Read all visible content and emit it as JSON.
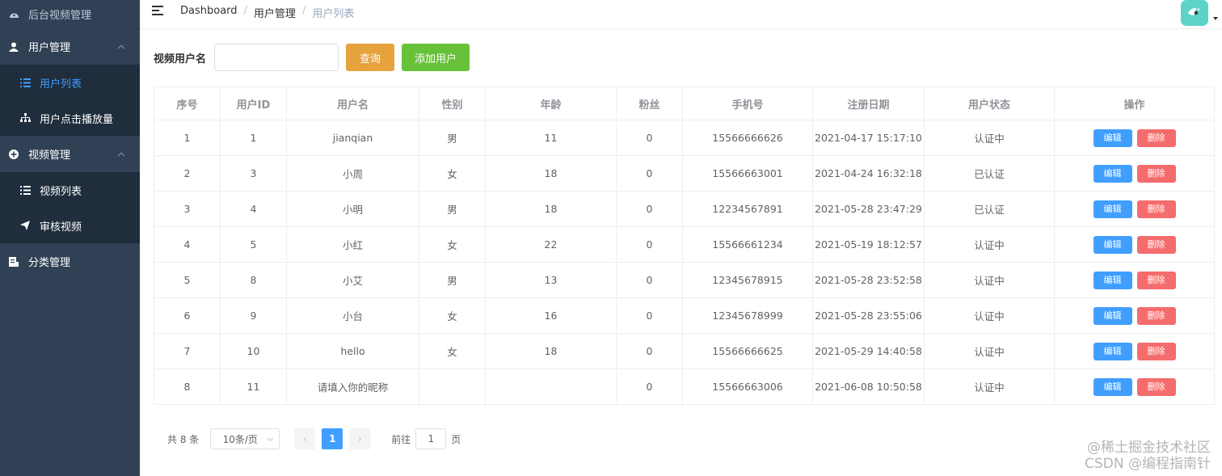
{
  "sidebar": {
    "items": [
      {
        "label": "后台视频管理",
        "icon": "dashboard-icon"
      },
      {
        "label": "用户管理",
        "icon": "user-icon"
      },
      {
        "label": "用户列表",
        "icon": "list-icon"
      },
      {
        "label": "用户点击播放量",
        "icon": "tree-icon"
      },
      {
        "label": "视频管理",
        "icon": "plus-circle-icon"
      },
      {
        "label": "视频列表",
        "icon": "list-icon"
      },
      {
        "label": "审核视频",
        "icon": "send-icon"
      },
      {
        "label": "分类管理",
        "icon": "document-icon"
      }
    ]
  },
  "header": {
    "breadcrumb": [
      "Dashboard",
      "用户管理",
      "用户列表"
    ],
    "separator": "/"
  },
  "search": {
    "label": "视频用户名",
    "value": "",
    "query_button": "查询",
    "add_button": "添加用户"
  },
  "table": {
    "columns": [
      "序号",
      "用户ID",
      "用户名",
      "性别",
      "年龄",
      "粉丝",
      "手机号",
      "注册日期",
      "用户状态",
      "操作"
    ],
    "edit_label": "编辑",
    "delete_label": "删除",
    "rows": [
      [
        "1",
        "1",
        "jianqian",
        "男",
        "11",
        "0",
        "15566666626",
        "2021-04-17 15:17:10",
        "认证中"
      ],
      [
        "2",
        "3",
        "小周",
        "女",
        "18",
        "0",
        "15566663001",
        "2021-04-24 16:32:18",
        "已认证"
      ],
      [
        "3",
        "4",
        "小明",
        "男",
        "18",
        "0",
        "12234567891",
        "2021-05-28 23:47:29",
        "已认证"
      ],
      [
        "4",
        "5",
        "小红",
        "女",
        "22",
        "0",
        "15566661234",
        "2021-05-19 18:12:57",
        "认证中"
      ],
      [
        "5",
        "8",
        "小艾",
        "男",
        "13",
        "0",
        "12345678915",
        "2021-05-28 23:52:58",
        "认证中"
      ],
      [
        "6",
        "9",
        "小台",
        "女",
        "16",
        "0",
        "12345678999",
        "2021-05-28 23:55:06",
        "认证中"
      ],
      [
        "7",
        "10",
        "hello",
        "女",
        "18",
        "0",
        "15566666625",
        "2021-05-29 14:40:58",
        "认证中"
      ],
      [
        "8",
        "11",
        "请填入你的昵称",
        "",
        "",
        "0",
        "15566663006",
        "2021-06-08 10:50:58",
        "认证中"
      ]
    ]
  },
  "pagination": {
    "total": "共 8 条",
    "page_size": "10条/页",
    "prev": "‹",
    "current": "1",
    "next": "›",
    "goto_label": "前往",
    "goto_value": "1",
    "page_suffix": "页"
  },
  "watermark": {
    "line1": "@稀土掘金技术社区",
    "line2": "CSDN @编程指南针"
  },
  "colors": {
    "sidebar_bg": "#304156",
    "submenu_bg": "#1f2d3d",
    "active": "#409eff",
    "warning": "#e6a23c",
    "success": "#67c23a",
    "danger": "#f56c6c"
  }
}
